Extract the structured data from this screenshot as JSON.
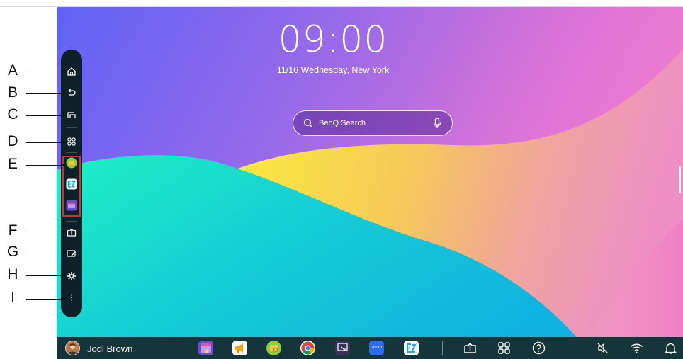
{
  "clock": {
    "time": "09:00",
    "date": "11/16 Wednesday, New York"
  },
  "search": {
    "placeholder": "BenQ Search"
  },
  "user": {
    "name": "Jodi Brown"
  },
  "labels": [
    "A",
    "B",
    "C",
    "D",
    "E",
    "F",
    "G",
    "H",
    "I"
  ],
  "dock": {
    "items": [
      {
        "name": "home-icon"
      },
      {
        "name": "back-icon"
      },
      {
        "name": "recent-apps-icon"
      },
      {
        "name": "all-apps-icon"
      },
      {
        "name": "file-manager-app-icon"
      },
      {
        "name": "ez-write-app-icon"
      },
      {
        "name": "gallery-app-icon"
      },
      {
        "name": "screen-share-icon"
      },
      {
        "name": "whiteboard-icon"
      },
      {
        "name": "tools-icon"
      },
      {
        "name": "more-icon"
      }
    ]
  },
  "taskbar": {
    "apps": [
      "gallery-app",
      "announcement-app",
      "file-manager-app",
      "chrome-app",
      "cast-app",
      "zoom-app",
      "ez-write-app"
    ],
    "zoom_label": "zoom",
    "system_icons": [
      "screen-share-icon",
      "apps-grid-icon",
      "help-icon",
      "mute-icon",
      "wifi-icon",
      "notification-icon"
    ]
  },
  "colors": {
    "dock_bg": "#0e2128",
    "taskbar_bg": "#15353a",
    "highlight_box": "#d32f2f",
    "wallpaper_top": "#6b5bf2",
    "wallpaper_teal": "#19e8c5",
    "wallpaper_yellow": "#f8ea3c",
    "wallpaper_pink": "#ec70d2"
  }
}
